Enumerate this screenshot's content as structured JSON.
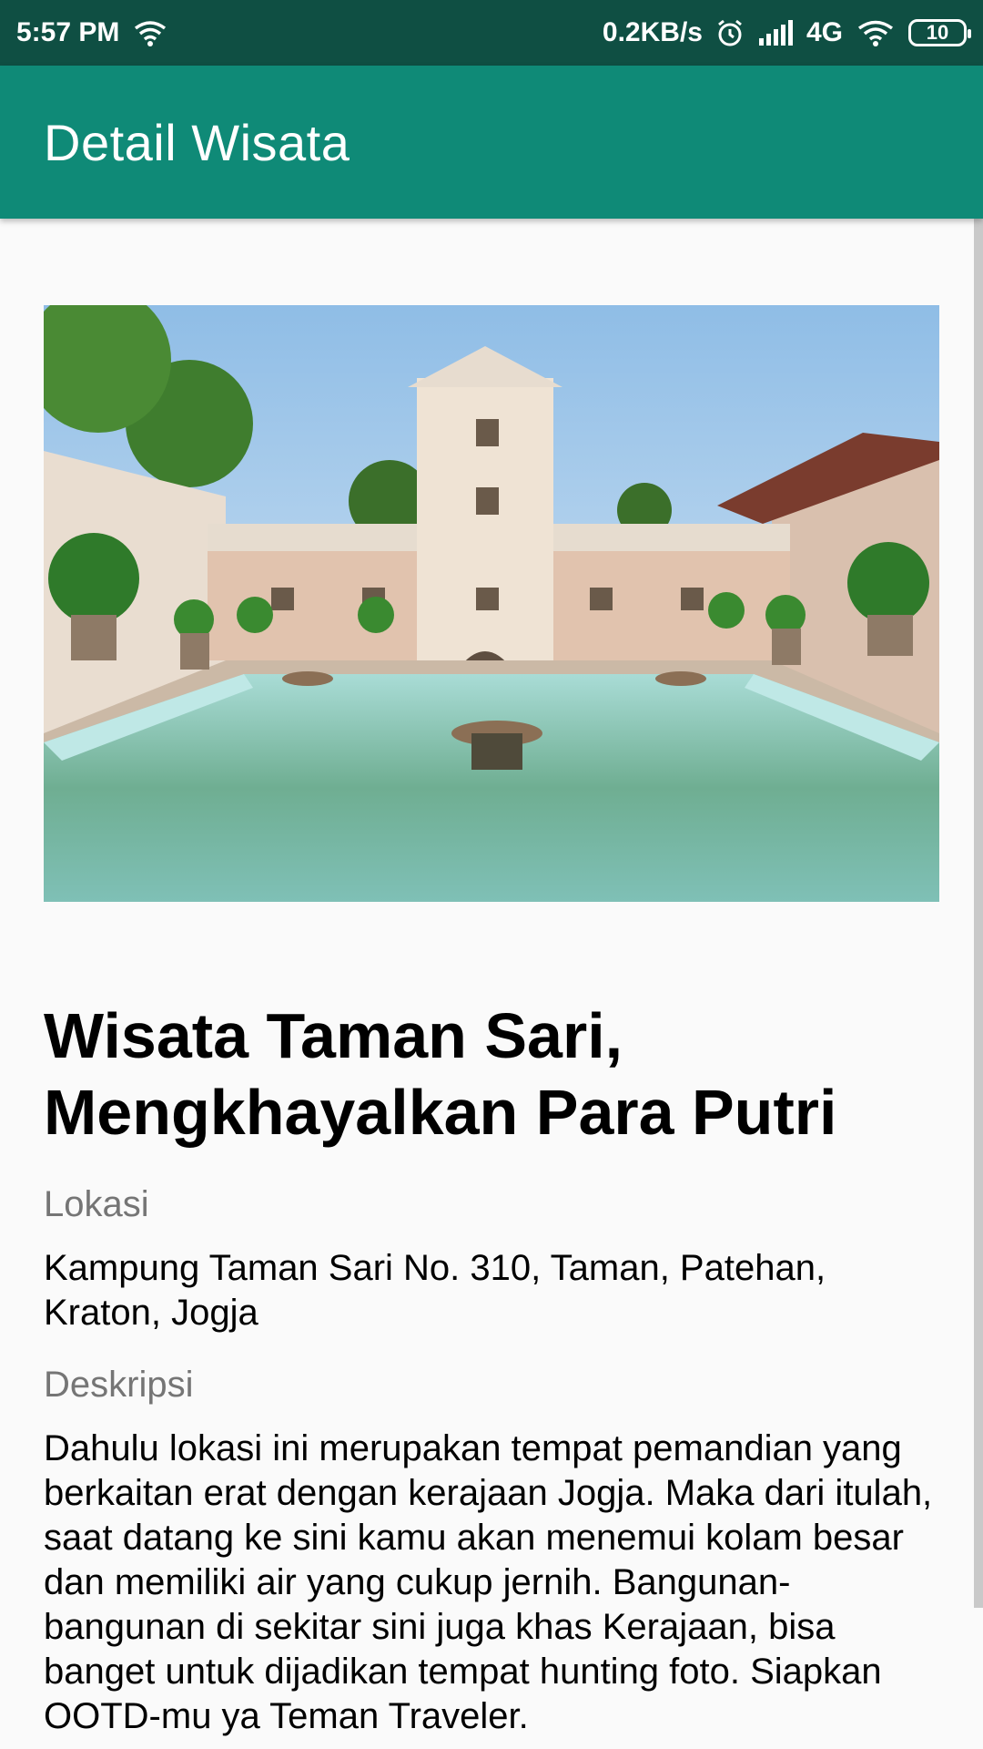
{
  "status_bar": {
    "time": "5:57 PM",
    "speed": "0.2KB/s",
    "network": "4G",
    "battery": "10",
    "icons": [
      "wifi-icon",
      "alarm-icon",
      "signal-icon",
      "wifi-icon",
      "battery-icon"
    ]
  },
  "app_bar": {
    "title": "Detail Wisata"
  },
  "detail": {
    "title": "Wisata Taman Sari, Mengkhayalkan Para Putri",
    "location_label": "Lokasi",
    "location": "Kampung Taman Sari No. 310, Taman, Patehan, Kraton, Jogja",
    "description_label": "Deskripsi",
    "description": "Dahulu lokasi ini merupakan tempat pemandian yang berkaitan erat dengan kerajaan Jogja. Maka dari itulah, saat datang ke sini kamu akan menemui kolam besar dan memiliki air yang cukup jernih. Bangunan-bangunan di sekitar sini juga khas Kerajaan, bisa banget untuk dijadikan tempat hunting foto. Siapkan OOTD-mu ya Teman Traveler."
  },
  "colors": {
    "status_bar": "#0f4f43",
    "app_bar": "#0f8a77",
    "background": "#fafafa"
  }
}
